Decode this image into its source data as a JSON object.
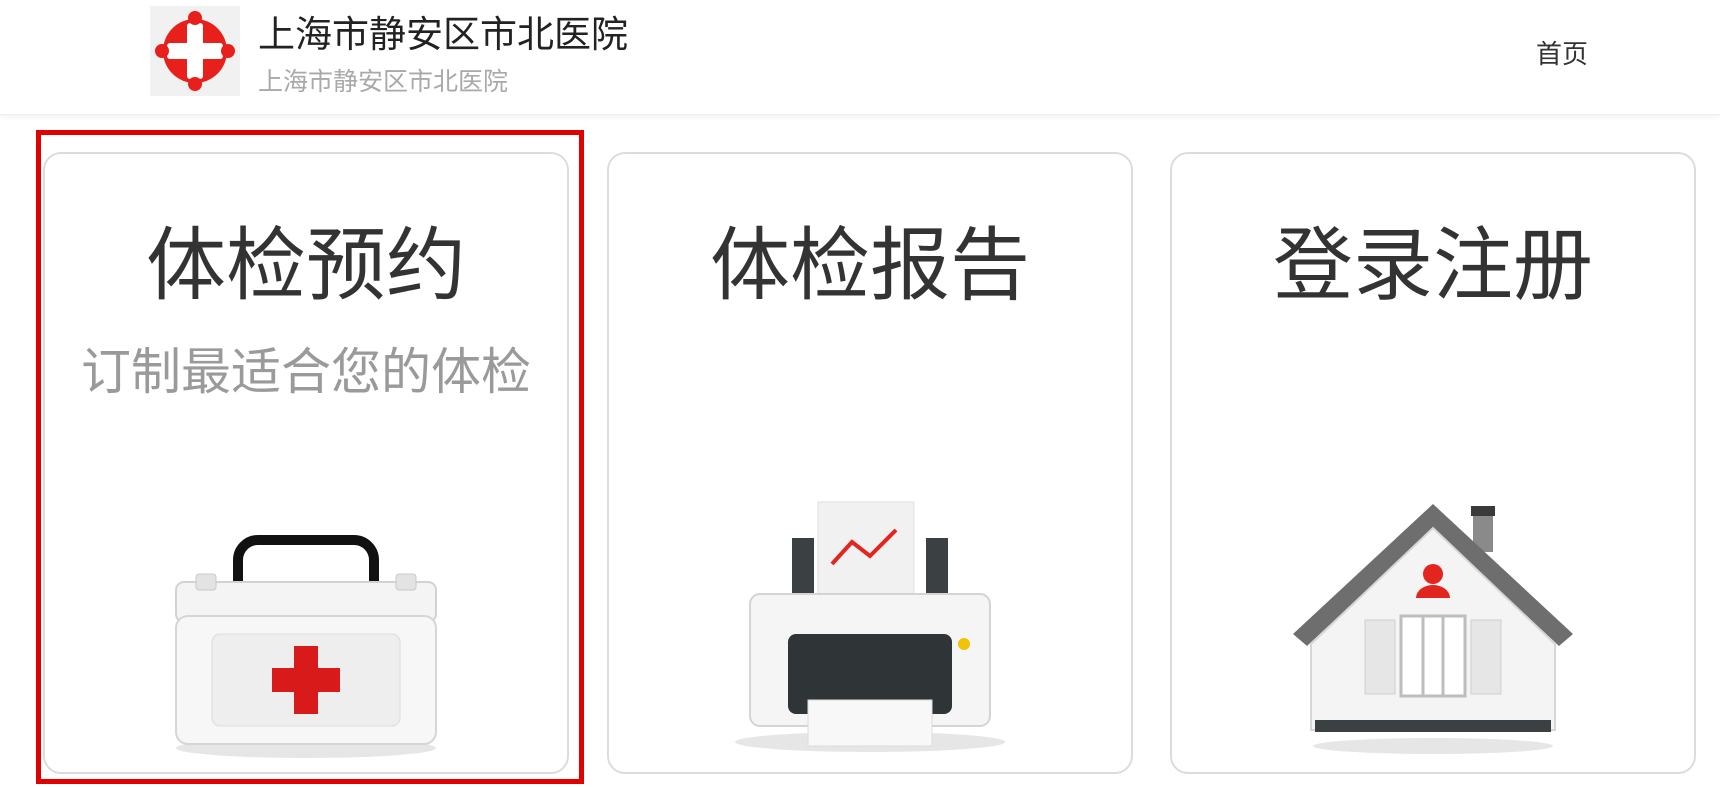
{
  "header": {
    "hospital_name": "上海市静安区市北医院",
    "hospital_subtitle": "上海市静安区市北医院",
    "nav_home": "首页"
  },
  "cards": [
    {
      "title": "体检预约",
      "subtitle": "订制最适合您的体检",
      "icon": "medical-kit-icon"
    },
    {
      "title": "体检报告",
      "subtitle": "",
      "icon": "printer-report-icon"
    },
    {
      "title": "登录注册",
      "subtitle": "",
      "icon": "house-user-icon"
    }
  ],
  "colors": {
    "brand_red": "#e10000",
    "card_border": "#dcdcdc",
    "title_text": "#333333",
    "subtitle_text": "#9a9a9a"
  }
}
